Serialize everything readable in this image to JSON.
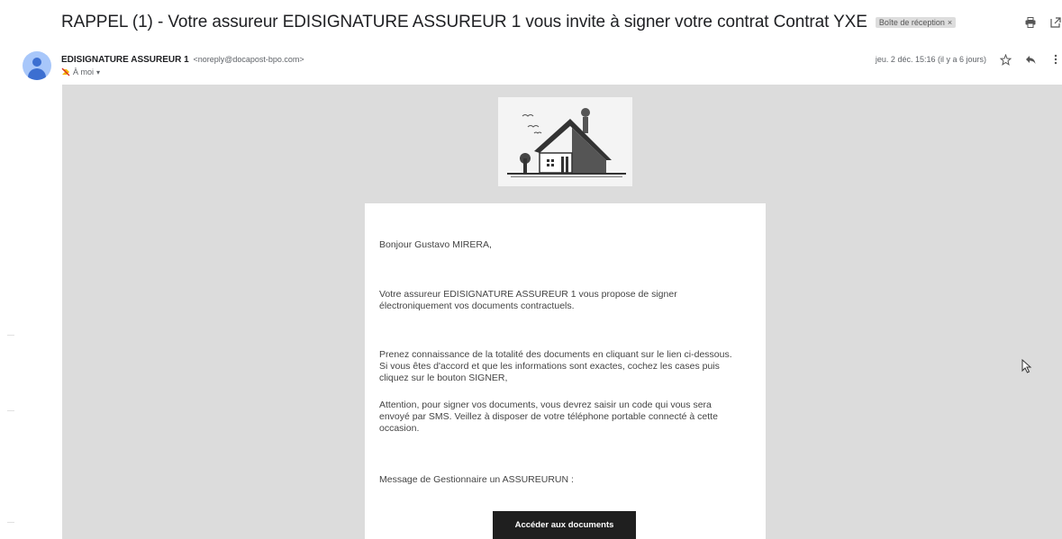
{
  "subject": {
    "title": "RAPPEL (1) - Votre assureur EDISIGNATURE ASSUREUR 1 vous invite à signer votre contrat Contrat YXE",
    "label": "Boîte de réception",
    "label_close": "×"
  },
  "sender": {
    "name": "EDISIGNATURE ASSUREUR 1",
    "email": "<noreply@docapost-bpo.com>",
    "to": "À moi"
  },
  "meta": {
    "date": "jeu. 2 déc. 15:16 (il y a 6 jours)"
  },
  "body": {
    "greeting": "Bonjour Gustavo MIRERA,",
    "para1": "Votre assureur EDISIGNATURE ASSUREUR 1 vous propose de signer électroniquement vos documents contractuels.",
    "para2": "Prenez connaissance de la totalité des documents en cliquant sur le lien ci-dessous. Si vous êtes d'accord et que les informations sont exactes, cochez les cases puis cliquez sur le bouton SIGNER,",
    "para3": "Attention, pour signer vos documents, vous devrez saisir un code qui vous sera envoyé par SMS. Veillez à disposer de votre téléphone portable connecté à cette occasion.",
    "para4": "Message de Gestionnaire un ASSUREURUN :",
    "cta_label": "Accéder aux documents"
  },
  "icons": {
    "print": "print-icon",
    "open_new": "open-in-new-window-icon",
    "star": "star-icon",
    "reply": "reply-icon",
    "more": "more-vertical-icon",
    "important": "important-marker-icon",
    "avatar": "default-avatar-icon",
    "logo": "house-logo-icon"
  },
  "colors": {
    "email_background": "#dcdcdc",
    "button": "#1f1f1f",
    "label_chip": "#dddddd",
    "avatar": "#3c6fd1",
    "important": "#d93025"
  }
}
